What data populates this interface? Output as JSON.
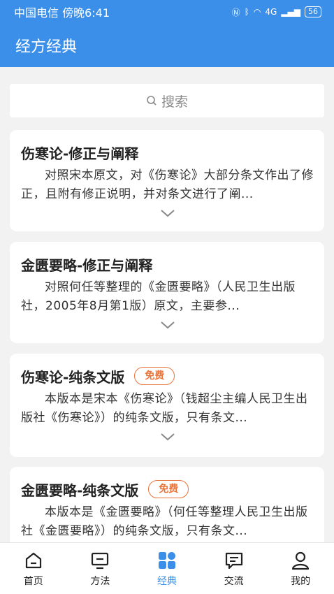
{
  "status": {
    "carrier_time": "中国电信 傍晚6:41",
    "network": "4G",
    "battery": "56"
  },
  "header": {
    "title": "经方经典"
  },
  "search": {
    "placeholder": "搜索"
  },
  "books": [
    {
      "title": "伤寒论-修正与阐释",
      "badge": "",
      "desc": "对照宋本原文，对《伤寒论》大部分条文作出了修正，且附有修正说明，并对条文进行了阐..."
    },
    {
      "title": "金匮要略-修正与阐释",
      "badge": "",
      "desc": "对照何任等整理的《金匮要略》（人民卫生出版社，2005年8月第1版）原文，主要参..."
    },
    {
      "title": "伤寒论-纯条文版",
      "badge": "免费",
      "desc": "本版本是宋本《伤寒论》（钱超尘主编人民卫生出版社《伤寒论》）的纯条文版，只有条文..."
    },
    {
      "title": "金匮要略-纯条文版",
      "badge": "免费",
      "desc": "本版本是《金匮要略》（何任等整理人民卫生出版社《金匮要略》）的纯条文版，只有条文..."
    }
  ],
  "tabs": [
    {
      "label": "首页",
      "icon": "home-icon"
    },
    {
      "label": "方法",
      "icon": "monitor-icon"
    },
    {
      "label": "经典",
      "icon": "grid-icon"
    },
    {
      "label": "交流",
      "icon": "chat-icon"
    },
    {
      "label": "我的",
      "icon": "user-icon"
    }
  ],
  "colors": {
    "primary": "#3b8fe8",
    "badge": "#e8743a"
  }
}
